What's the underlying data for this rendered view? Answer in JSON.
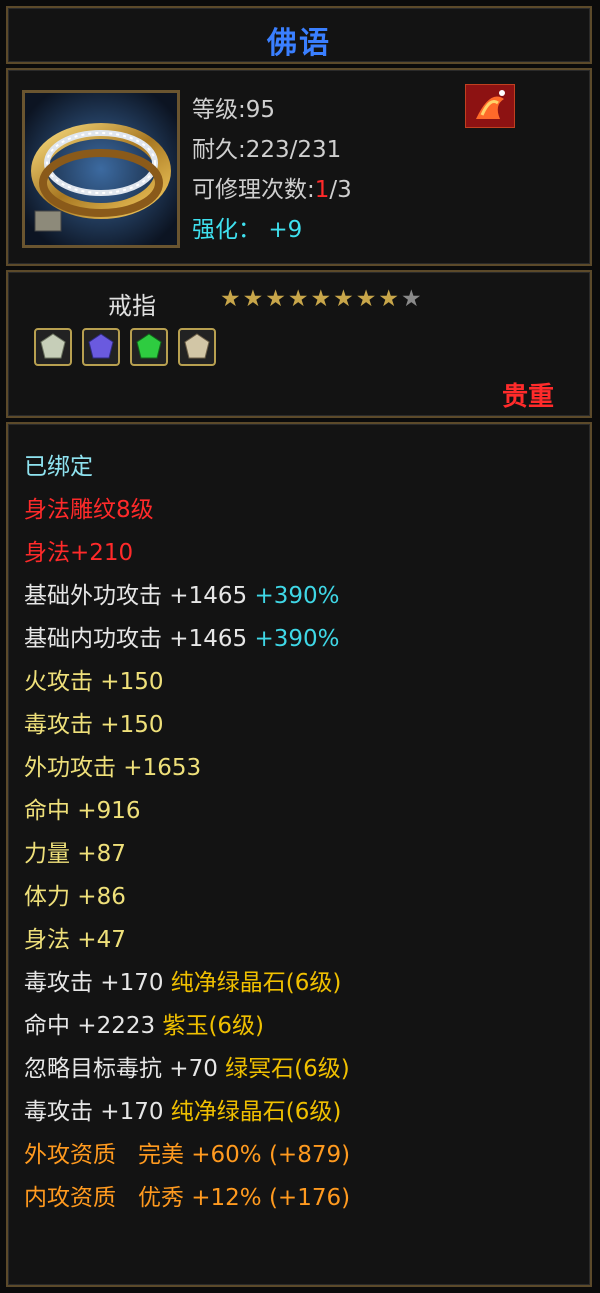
{
  "header": {
    "title": "佛语"
  },
  "item": {
    "level_label": "等级",
    "level_value": ":95",
    "durability_label": "耐久",
    "durability_value": ":223/231",
    "repair_label": "可修理次数",
    "repair_current": ":1",
    "repair_max": "/3",
    "enhance_label": "强化：",
    "enhance_value": "+9",
    "type": "戒指",
    "stars_filled": 8,
    "stars_total": 9,
    "quality": "贵重",
    "gems": [
      {
        "icon": "gem-white-icon",
        "color": "#bfc8b4"
      },
      {
        "icon": "gem-purple-icon",
        "color": "#6a5adf"
      },
      {
        "icon": "gem-green-icon",
        "color": "#2ecc40"
      },
      {
        "icon": "gem-white-icon",
        "color": "#c9bfa6"
      }
    ]
  },
  "stats": {
    "bound": "已绑定",
    "engraving": "身法雕纹8级",
    "agility_bonus": "身法+210",
    "outer_base": "基础外功攻击 +1465",
    "outer_base_pct": "+390%",
    "inner_base": "基础内功攻击 +1465",
    "inner_base_pct": "+390%",
    "fire": "火攻击 +150",
    "poison": "毒攻击 +150",
    "outer": "外功攻击 +1653",
    "hit": "命中 +916",
    "strength": "力量 +87",
    "stamina": "体力 +86",
    "agility": "身法 +47",
    "gem1_attr": "毒攻击 +170",
    "gem1_name": "纯净绿晶石(6级)",
    "gem2_attr": "命中 +2223",
    "gem2_name": "紫玉(6级)",
    "gem3_attr": "忽略目标毒抗 +70",
    "gem3_name": "绿冥石(6级)",
    "gem4_attr": "毒攻击 +170",
    "gem4_name": "纯净绿晶石(6级)",
    "outer_aptitude": "外攻资质",
    "outer_aptitude_grade": "完美",
    "outer_aptitude_value": "+60% (+879)",
    "inner_aptitude": "内攻资质",
    "inner_aptitude_grade": "优秀",
    "inner_aptitude_value": "+12% (+176)"
  }
}
